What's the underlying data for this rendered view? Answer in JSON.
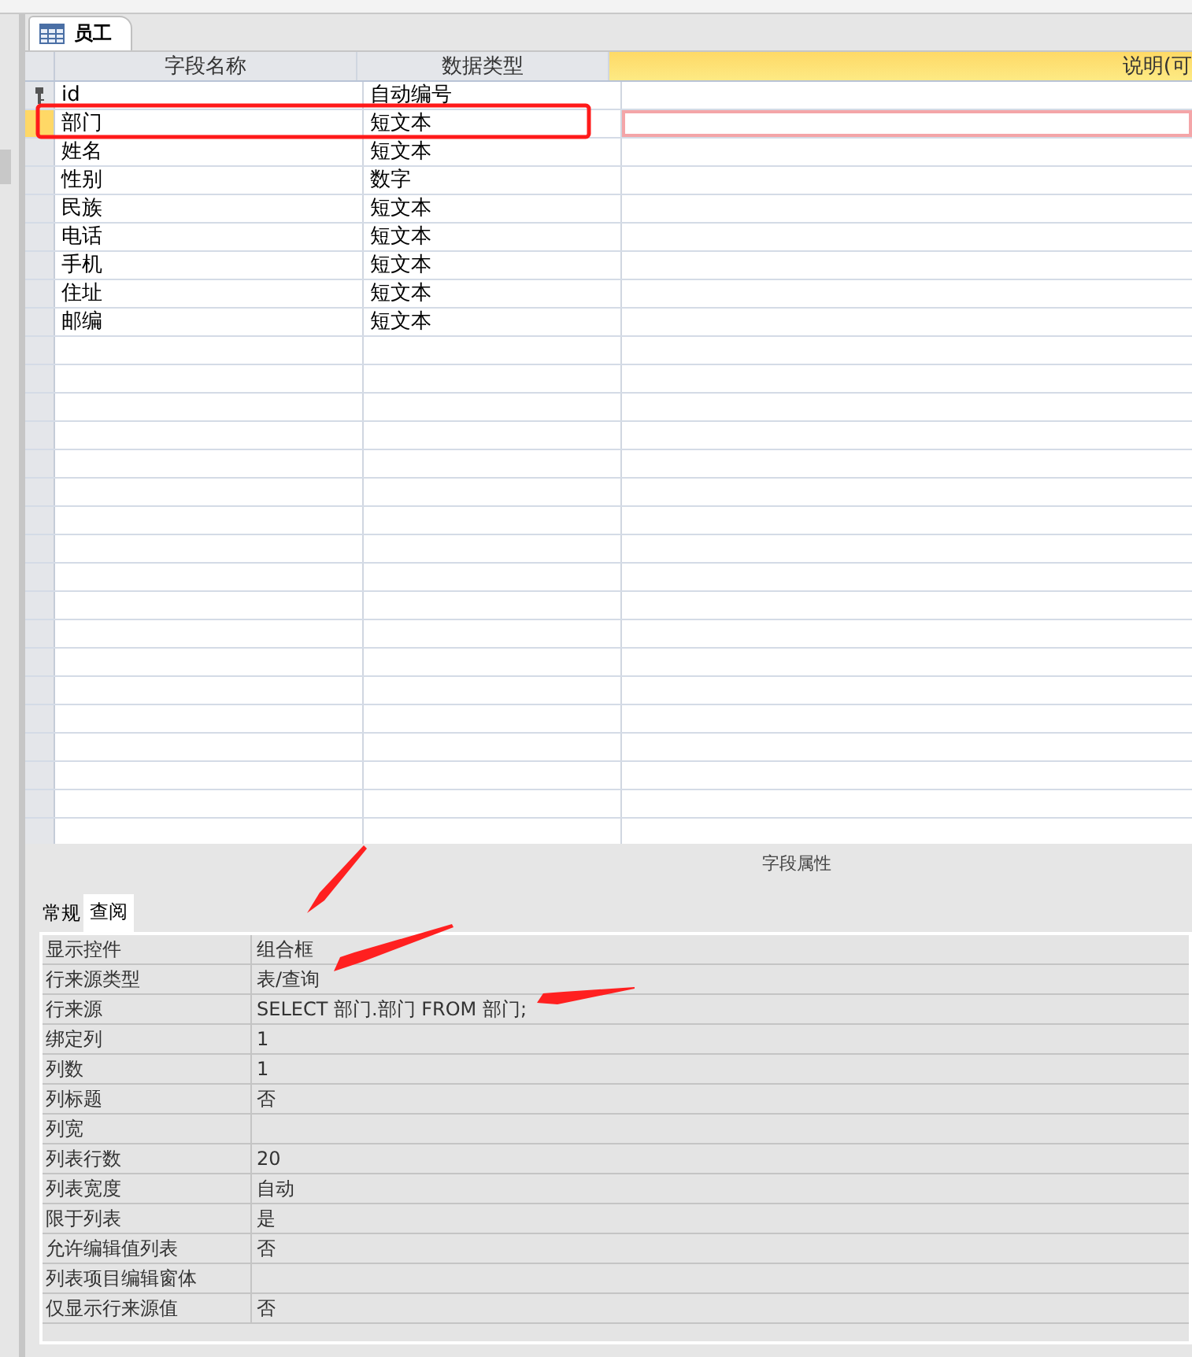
{
  "document_tab": {
    "title": "员工"
  },
  "design_grid": {
    "columns": [
      "字段名称",
      "数据类型",
      "说明(可"
    ],
    "fields": [
      {
        "name": "id",
        "type": "自动编号",
        "primary_key": true,
        "selected": false
      },
      {
        "name": "部门",
        "type": "短文本",
        "primary_key": false,
        "selected": true
      },
      {
        "name": "姓名",
        "type": "短文本",
        "primary_key": false,
        "selected": false
      },
      {
        "name": "性别",
        "type": "数字",
        "primary_key": false,
        "selected": false
      },
      {
        "name": "民族",
        "type": "短文本",
        "primary_key": false,
        "selected": false
      },
      {
        "name": "电话",
        "type": "短文本",
        "primary_key": false,
        "selected": false
      },
      {
        "name": "手机",
        "type": "短文本",
        "primary_key": false,
        "selected": false
      },
      {
        "name": "住址",
        "type": "短文本",
        "primary_key": false,
        "selected": false
      },
      {
        "name": "邮编",
        "type": "短文本",
        "primary_key": false,
        "selected": false
      }
    ]
  },
  "field_properties": {
    "title": "字段属性",
    "tabs": [
      {
        "label": "常规",
        "selected": false
      },
      {
        "label": "查阅",
        "selected": true
      }
    ],
    "properties": [
      {
        "label": "显示控件",
        "value": "组合框"
      },
      {
        "label": "行来源类型",
        "value": "表/查询"
      },
      {
        "label": "行来源",
        "value": "SELECT 部门.部门 FROM 部门;"
      },
      {
        "label": "绑定列",
        "value": "1"
      },
      {
        "label": "列数",
        "value": "1"
      },
      {
        "label": "列标题",
        "value": "否"
      },
      {
        "label": "列宽"
      },
      {
        "label": "列表行数",
        "value": "20"
      },
      {
        "label": "列表宽度",
        "value": "自动"
      },
      {
        "label": "限于列表",
        "value": "是"
      },
      {
        "label": "允许编辑值列表",
        "value": "否"
      },
      {
        "label": "列表项目编辑窗体"
      },
      {
        "label": "仅显示行来源值",
        "value": "否"
      }
    ]
  }
}
